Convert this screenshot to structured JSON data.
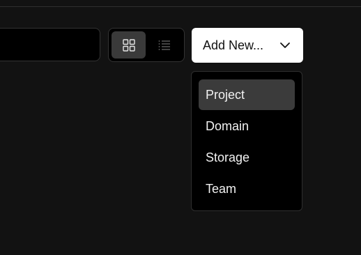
{
  "toolbar": {
    "view_toggle": {
      "grid_icon": "grid-icon",
      "list_icon": "list-icon",
      "active": "grid"
    },
    "add_new": {
      "label": "Add New...",
      "icon": "chevron-down-icon"
    }
  },
  "dropdown": {
    "items": [
      {
        "label": "Project",
        "selected": true
      },
      {
        "label": "Domain",
        "selected": false
      },
      {
        "label": "Storage",
        "selected": false
      },
      {
        "label": "Team",
        "selected": false
      }
    ]
  },
  "colors": {
    "background": "#121212",
    "menu_background": "#000000",
    "selected_item": "#3b3b3b",
    "button_background": "#ffffff"
  }
}
